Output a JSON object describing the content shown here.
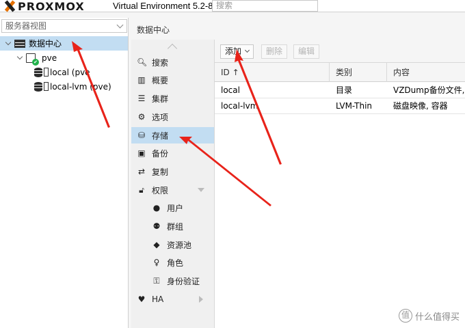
{
  "header": {
    "logo_text": "PROXMOX",
    "version": "Virtual Environment 5.2-8",
    "search_placeholder": "搜索"
  },
  "left": {
    "view_select": "服务器视图",
    "tree": [
      {
        "label": "数据中心",
        "selected": true
      },
      {
        "label": "pve"
      },
      {
        "label": "local (pve"
      },
      {
        "label": "local-lvm (pve)"
      }
    ]
  },
  "content": {
    "title": "数据中心"
  },
  "menu": {
    "items": [
      {
        "label": "搜索",
        "icon": "search-icon"
      },
      {
        "label": "概要",
        "icon": "book-icon"
      },
      {
        "label": "集群",
        "icon": "server-icon"
      },
      {
        "label": "选项",
        "icon": "gear-icon"
      },
      {
        "label": "存储",
        "icon": "database-icon",
        "selected": true
      },
      {
        "label": "备份",
        "icon": "floppy-icon"
      },
      {
        "label": "复制",
        "icon": "retweet-icon"
      },
      {
        "label": "权限",
        "icon": "unlock-icon"
      },
      {
        "label": "用户",
        "icon": "user-icon"
      },
      {
        "label": "群组",
        "icon": "users-icon"
      },
      {
        "label": "资源池",
        "icon": "tags-icon"
      },
      {
        "label": "角色",
        "icon": "male-icon"
      },
      {
        "label": "身份验证",
        "icon": "key-icon"
      },
      {
        "label": "HA",
        "icon": "heartbeat-icon"
      }
    ]
  },
  "toolbar": {
    "add_label": "添加",
    "delete_label": "删除",
    "edit_label": "编辑"
  },
  "grid": {
    "columns": [
      "ID ↑",
      "类别",
      "内容"
    ],
    "rows": [
      {
        "id": "local",
        "type": "目录",
        "content": "VZDump备份文件, I"
      },
      {
        "id": "local-lvm",
        "type": "LVM-Thin",
        "content": "磁盘映像, 容器"
      }
    ]
  },
  "watermark": {
    "text": "什么值得买",
    "icon_glyph": "值"
  },
  "colors": {
    "selection": "#c2ddf2",
    "arrow": "#e8231a",
    "brand_orange": "#e57000"
  }
}
